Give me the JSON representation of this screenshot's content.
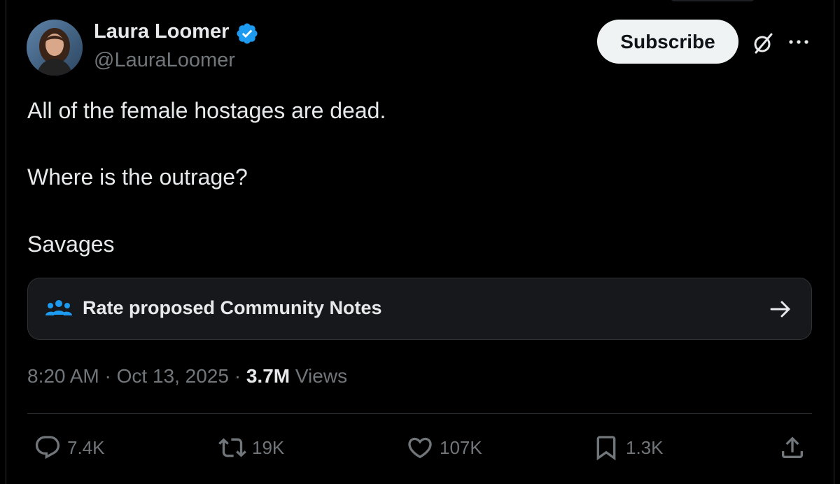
{
  "author": {
    "name": "Laura Loomer",
    "handle": "@LauraLoomer",
    "verified_color": "#1d9bf0"
  },
  "header": {
    "subscribe_label": "Subscribe",
    "icons": [
      "grok-icon",
      "more-icon"
    ]
  },
  "tweet": {
    "lines": [
      "All of the female hostages are dead.",
      "Where is the outrage?",
      "Savages"
    ]
  },
  "community_notes": {
    "label": "Rate proposed Community Notes",
    "icon": "people-icon",
    "accent": "#1d9bf0"
  },
  "meta": {
    "time": "8:20 AM",
    "date": "Oct 13, 2025",
    "views_count": "3.7M",
    "views_label": "Views"
  },
  "actions": {
    "replies": "7.4K",
    "reposts": "19K",
    "likes": "107K",
    "bookmarks": "1.3K"
  },
  "colors": {
    "background": "#000000",
    "text": "#e7e9ea",
    "muted": "#71767b",
    "border": "#2f3336"
  }
}
